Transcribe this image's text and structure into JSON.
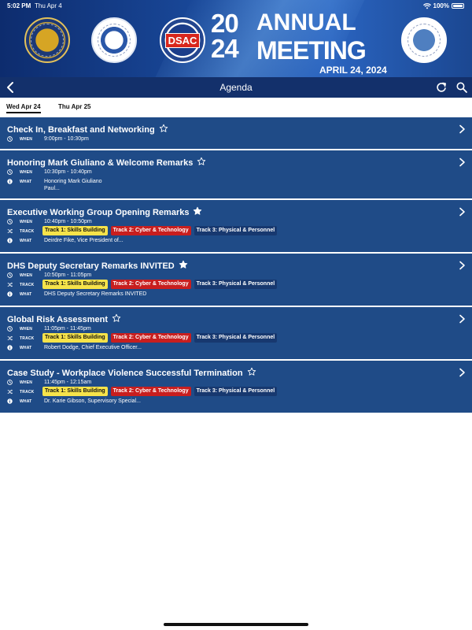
{
  "status_bar": {
    "time": "5:02 PM",
    "date": "Thu Apr 4",
    "battery": "100%"
  },
  "banner": {
    "year_top": "20",
    "year_bottom": "24",
    "line1": "ANNUAL",
    "line2": "MEETING",
    "date": "APRIL 24, 2024",
    "dsac_label": "DSAC"
  },
  "nav": {
    "title": "Agenda"
  },
  "tabs": [
    {
      "label": "Wed Apr 24"
    },
    {
      "label": "Thu Apr 25"
    }
  ],
  "labels": {
    "when": "WHEN",
    "what": "WHAT",
    "track": "TRACK"
  },
  "track_badges": {
    "t1": "Track 1: Skills Building",
    "t2": "Track 2: Cyber & Technology",
    "t3": "Track 3: Physical & Personnel"
  },
  "sessions": [
    {
      "title": "Check In, Breakfast and Networking",
      "when": "9:00pm - 10:30pm"
    },
    {
      "title": "Honoring Mark Giuliano & Welcome Remarks",
      "when": "10:30pm - 10:40pm",
      "what": "Honoring Mark Giuliano",
      "what2": "Paul..."
    },
    {
      "title": "Executive Working Group Opening Remarks",
      "when": "10:40pm - 10:50pm",
      "what": "Deirdre Fike, Vice President of..."
    },
    {
      "title": "DHS Deputy Secretary Remarks INVITED",
      "when": "10:50pm - 11:05pm",
      "what": "DHS Deputy Secretary Remarks INVITED"
    },
    {
      "title": "Global Risk Assessment",
      "when": "11:05pm - 11:45pm",
      "what": "Robert Dodge, Chief Executive Officer..."
    },
    {
      "title": "Case Study - Workplace Violence Successful Termination",
      "when": "11:45pm - 12:15am",
      "what": "Dr. Karie Gibson, Supervisory Special..."
    }
  ],
  "colors": {
    "banner": "#1a4a9c",
    "navbar": "#13306b",
    "session_bg": "#1f4b87",
    "track1": "#f6e34a",
    "track2": "#c81e1e",
    "track3": "#17386f"
  },
  "icons": {
    "back": "chevron-left-icon",
    "refresh": "refresh-icon",
    "search": "search-icon",
    "star": "star-icon",
    "clock": "clock-icon",
    "shuffle": "shuffle-icon",
    "info": "info-icon",
    "disclosure": "chevron-right-icon"
  }
}
